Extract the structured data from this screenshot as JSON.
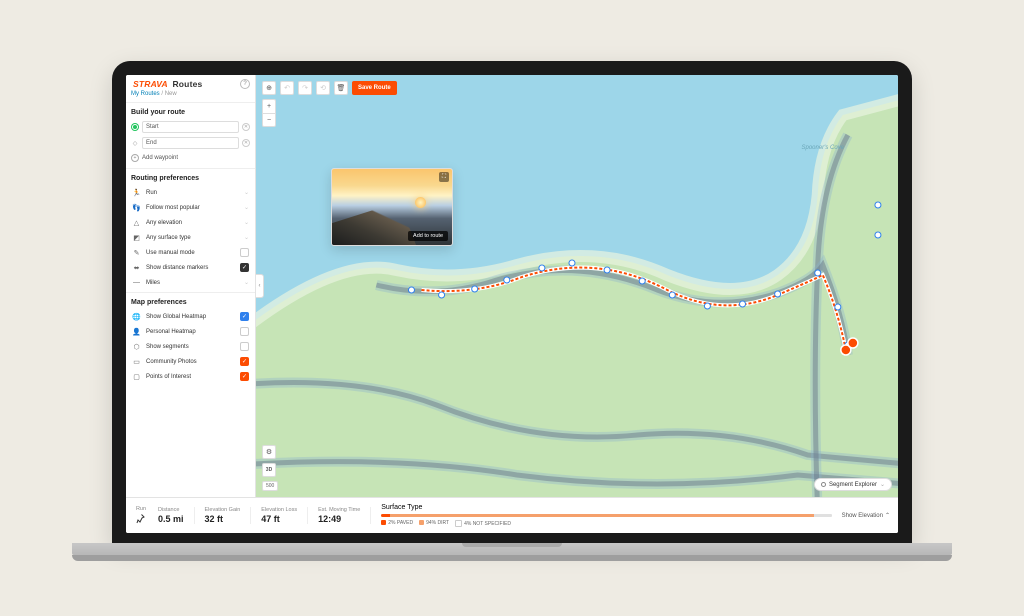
{
  "header": {
    "brand": "STRAVA",
    "section": "Routes",
    "breadcrumb_root": "My Routes",
    "breadcrumb_leaf": "New"
  },
  "sidebar": {
    "build_title": "Build your route",
    "start_placeholder": "Start",
    "end_placeholder": "End",
    "add_waypoint": "Add waypoint",
    "routing_title": "Routing preferences",
    "routing": [
      {
        "icon": "run",
        "label": "Run",
        "type": "chevron"
      },
      {
        "icon": "popular",
        "label": "Follow most popular",
        "type": "chevron"
      },
      {
        "icon": "elevation",
        "label": "Any elevation",
        "type": "chevron"
      },
      {
        "icon": "surface",
        "label": "Any surface type",
        "type": "chevron"
      },
      {
        "icon": "manual",
        "label": "Use manual mode",
        "type": "checkbox",
        "checked": false
      },
      {
        "icon": "markers",
        "label": "Show distance markers",
        "type": "checkbox",
        "checked": true,
        "variant": "dark"
      },
      {
        "icon": "units",
        "label": "Miles",
        "type": "chevron"
      }
    ],
    "map_title": "Map preferences",
    "map_prefs": [
      {
        "icon": "heatmap",
        "label": "Show Global Heatmap",
        "checked": true,
        "variant": "blue"
      },
      {
        "icon": "personal",
        "label": "Personal Heatmap",
        "checked": false
      },
      {
        "icon": "segments",
        "label": "Show segments",
        "checked": false
      },
      {
        "icon": "photos",
        "label": "Community Photos",
        "checked": true,
        "variant": "orange"
      },
      {
        "icon": "poi",
        "label": "Points of Interest",
        "checked": true,
        "variant": "orange"
      }
    ]
  },
  "map": {
    "toolbar": {
      "save": "Save Route"
    },
    "cove_label": "Spooner's Cove",
    "three_d": "3D",
    "scale": "500",
    "segment_explorer": "Segment Explorer",
    "photo": {
      "add_to_route": "Add to route"
    }
  },
  "stats": {
    "activity_label": "Run",
    "distance_label": "Distance",
    "distance_value": "0.5 mi",
    "gain_label": "Elevation Gain",
    "gain_value": "32 ft",
    "loss_label": "Elevation Loss",
    "loss_value": "47 ft",
    "time_label": "Est. Moving Time",
    "time_value": "12:49",
    "surface_label": "Surface Type",
    "surface": {
      "paved_pct": 2,
      "dirt_pct": 94,
      "unspec_pct": 4
    },
    "legend_paved": "2% PAVED",
    "legend_dirt": "94% DIRT",
    "legend_unspec": "4% NOT SPECIFIED",
    "show_elevation": "Show Elevation"
  }
}
